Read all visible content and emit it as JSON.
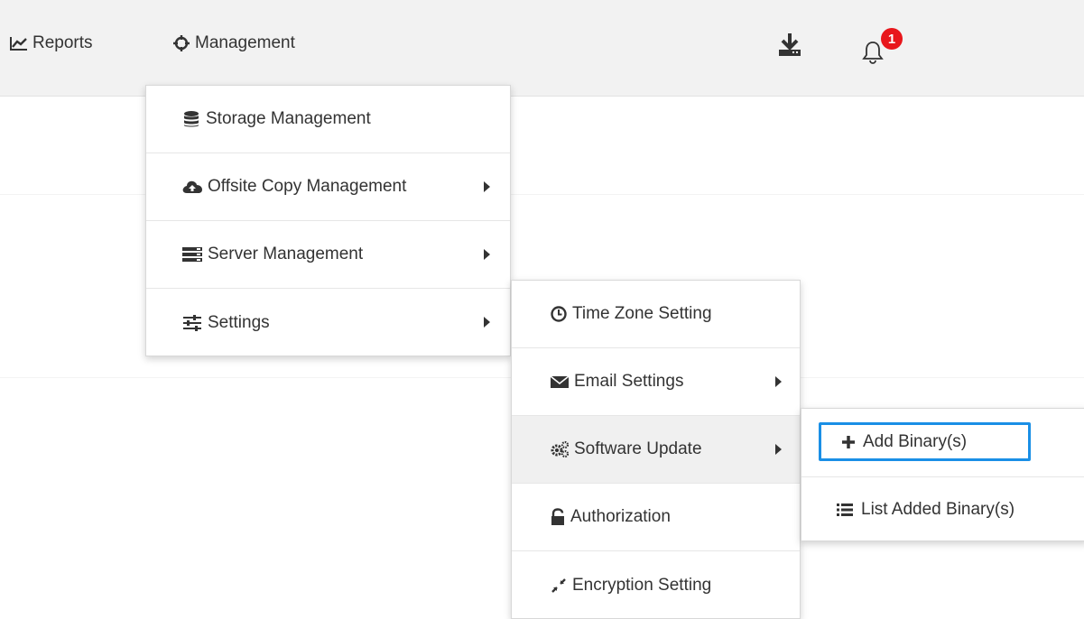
{
  "header": {
    "nav": [
      {
        "label": "Reports",
        "icon": "line-chart-icon"
      },
      {
        "label": "Management",
        "icon": "crosshair-icon"
      }
    ],
    "download_icon": "download-icon",
    "notifications": {
      "icon": "bell-icon",
      "count": "1"
    }
  },
  "management_menu": [
    {
      "label": "Storage Management",
      "icon": "database-icon"
    },
    {
      "label": "Offsite Copy Management",
      "icon": "cloud-upload-icon"
    },
    {
      "label": "Server Management",
      "icon": "server-icon"
    },
    {
      "label": "Settings",
      "icon": "sliders-icon"
    }
  ],
  "settings_menu": [
    {
      "label": "Time Zone Setting",
      "icon": "clock-icon"
    },
    {
      "label": "Email Settings",
      "icon": "envelope-icon"
    },
    {
      "label": "Software Update",
      "icon": "cogs-icon"
    },
    {
      "label": "Authorization",
      "icon": "unlock-icon"
    },
    {
      "label": "Encryption Setting",
      "icon": "compress-icon"
    }
  ],
  "software_update_menu": [
    {
      "label": "Add Binary(s)",
      "icon": "plus-icon"
    },
    {
      "label": "List Added Binary(s)",
      "icon": "list-icon"
    }
  ],
  "colors": {
    "accent": "#1a8fe6",
    "badge": "#e8161b",
    "topbar": "#f2f2f2"
  }
}
